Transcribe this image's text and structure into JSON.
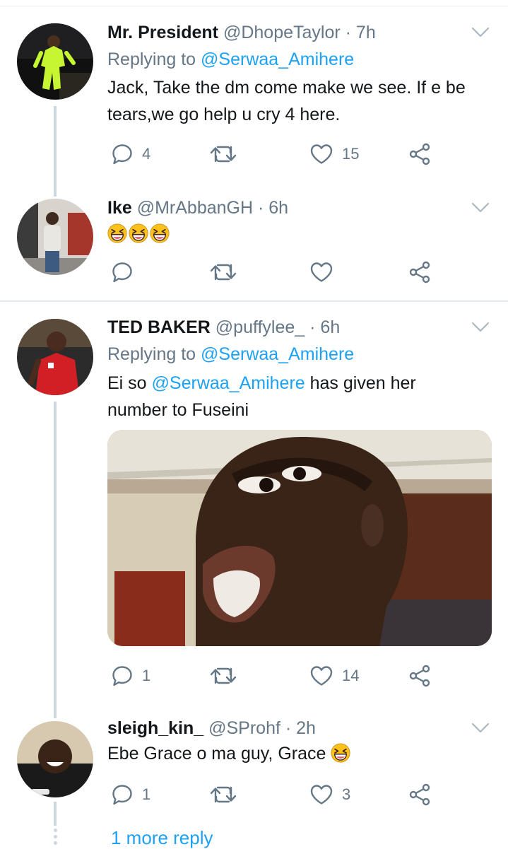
{
  "tweets": [
    {
      "name": "Mr. President",
      "handle": "@DhopeTaylor",
      "time": "7h",
      "replying_prefix": "Replying to ",
      "replying_to": "@Serwaa_Amihere",
      "text": "Jack, Take the dm come make we see. If e be tears,we go help u cry 4 here.",
      "replies": "4",
      "retweets": "",
      "likes": "15"
    },
    {
      "name": "Ike",
      "handle": "@MrAbbanGH",
      "time": "6h",
      "emoji_count": 3,
      "replies": "",
      "retweets": "",
      "likes": ""
    },
    {
      "name": "TED BAKER",
      "handle": "@puffylee_",
      "time": "6h",
      "replying_prefix": "Replying to ",
      "replying_to": "@Serwaa_Amihere",
      "text_before": "Ei so ",
      "text_mention": "@Serwaa_Amihere",
      "text_after": " has given her number to Fuseini",
      "replies": "1",
      "retweets": "",
      "likes": "14"
    },
    {
      "name": "sleigh_kin_",
      "handle": "@SProhf",
      "time": "2h",
      "text": "Ebe Grace o ma guy, Grace",
      "replies": "1",
      "retweets": "",
      "likes": "3"
    }
  ],
  "more_replies": "1 more reply",
  "separator": " · ",
  "colors": {
    "link": "#1da1f2",
    "muted": "#657786",
    "line": "#ccd6dd"
  },
  "icons": [
    "reply-icon",
    "retweet-icon",
    "like-icon",
    "share-icon",
    "chevron-down-icon",
    "grinning-squint-emoji"
  ]
}
